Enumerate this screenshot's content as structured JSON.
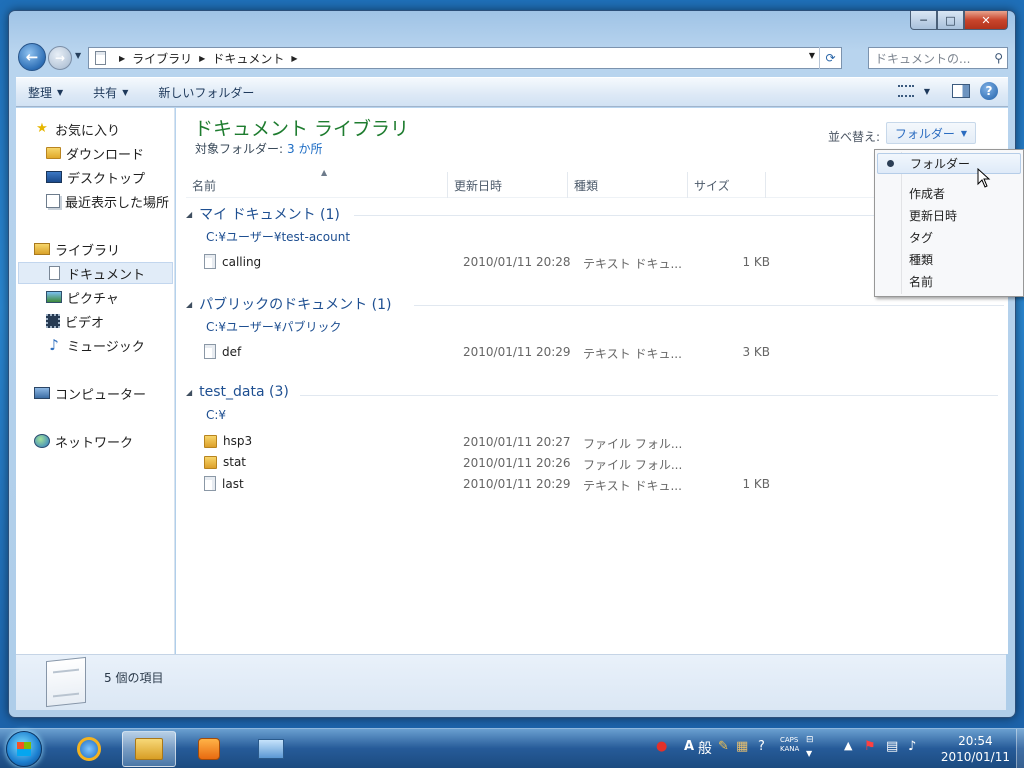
{
  "window": {
    "caption": {
      "minimize": "─",
      "maximize": "□",
      "close": "✕"
    }
  },
  "address": {
    "crumbs": [
      "ライブラリ",
      "ドキュメント"
    ],
    "search_placeholder": "ドキュメントの..."
  },
  "toolbar": {
    "organize": "整理",
    "share": "共有",
    "new_folder": "新しいフォルダー",
    "help": "?"
  },
  "nav": {
    "favorites": "お気に入り",
    "downloads": "ダウンロード",
    "desktop": "デスクトップ",
    "recent": "最近表示した場所",
    "libraries": "ライブラリ",
    "documents": "ドキュメント",
    "pictures": "ピクチャ",
    "videos": "ビデオ",
    "music": "ミュージック",
    "computer": "コンピューター",
    "network": "ネットワーク"
  },
  "content": {
    "title": "ドキュメント ライブラリ",
    "subtitle_label": "対象フォルダー:",
    "subtitle_link": "3 か所",
    "sort_label": "並べ替え:",
    "sort_value": "フォルダー"
  },
  "columns": {
    "name": "名前",
    "modified": "更新日時",
    "type": "種類",
    "size": "サイズ"
  },
  "groups": [
    {
      "title": "マイ ドキュメント (1)",
      "path": "C:¥ユーザー¥test-acount",
      "files": [
        {
          "name": "calling",
          "date": "2010/01/11 20:28",
          "type": "テキスト ドキュ...",
          "size": "1 KB"
        }
      ]
    },
    {
      "title": "パブリックのドキュメント (1)",
      "path": "C:¥ユーザー¥パブリック",
      "files": [
        {
          "name": "def",
          "date": "2010/01/11 20:29",
          "type": "テキスト ドキュ...",
          "size": "3 KB"
        }
      ]
    },
    {
      "title": "test_data (3)",
      "path": "C:¥",
      "files": [
        {
          "name": "hsp3",
          "date": "2010/01/11 20:27",
          "type": "ファイル フォル...",
          "size": ""
        },
        {
          "name": "stat",
          "date": "2010/01/11 20:26",
          "type": "ファイル フォル...",
          "size": ""
        },
        {
          "name": "last",
          "date": "2010/01/11 20:29",
          "type": "テキスト ドキュ...",
          "size": "1 KB"
        }
      ]
    }
  ],
  "sort_menu": [
    "フォルダー",
    "作成者",
    "更新日時",
    "タグ",
    "種類",
    "名前"
  ],
  "details": {
    "count": "5 個の項目"
  },
  "taskbar": {
    "ime_mode": "A",
    "ime_han": "般",
    "caps": "CAPS",
    "kana": "KANA",
    "time": "20:54",
    "date": "2010/01/11"
  }
}
